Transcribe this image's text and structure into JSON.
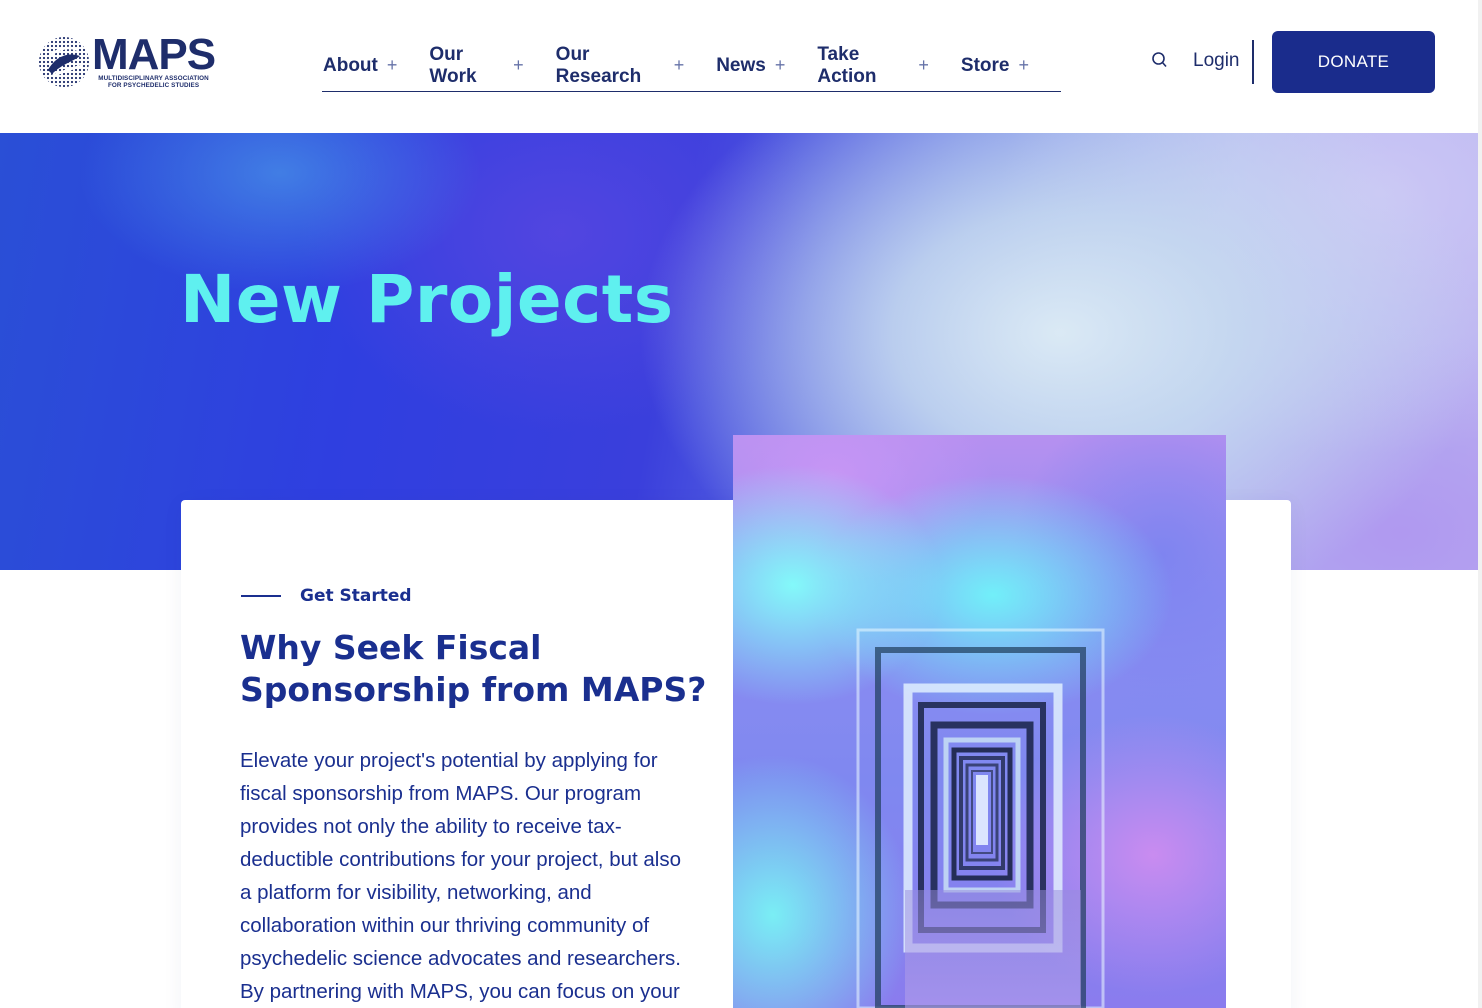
{
  "logo": {
    "wordmark": "MAPS",
    "sub_line1": "MULTIDISCIPLINARY ASSOCIATION",
    "sub_line2": "FOR PSYCHEDELIC STUDIES"
  },
  "nav": {
    "items": [
      {
        "label": "About"
      },
      {
        "label": "Our Work"
      },
      {
        "label": "Our Research"
      },
      {
        "label": "News"
      },
      {
        "label": "Take Action"
      },
      {
        "label": "Store"
      }
    ],
    "expand_glyph": "+"
  },
  "header": {
    "login_label": "Login",
    "donate_label": "DONATE"
  },
  "hero": {
    "title": "New Projects"
  },
  "card": {
    "eyebrow": "Get Started",
    "title": "Why Seek Fiscal Sponsorship from MAPS?",
    "body": "Elevate your project's potential by applying for fiscal sponsorship from MAPS. Our program provides not only the ability to receive tax-deductible contributions for your project, but also a platform for visibility, networking, and collaboration within our thriving community of psychedelic science advocates and researchers. By partnering with MAPS, you can focus on your"
  },
  "colors": {
    "brand_navy": "#1a2c8c",
    "hero_title": "#5ff0ef",
    "text": "#1a2f8f"
  },
  "icons": {
    "search": "search-icon",
    "logo_mark": "maps-globe-logo-icon"
  }
}
